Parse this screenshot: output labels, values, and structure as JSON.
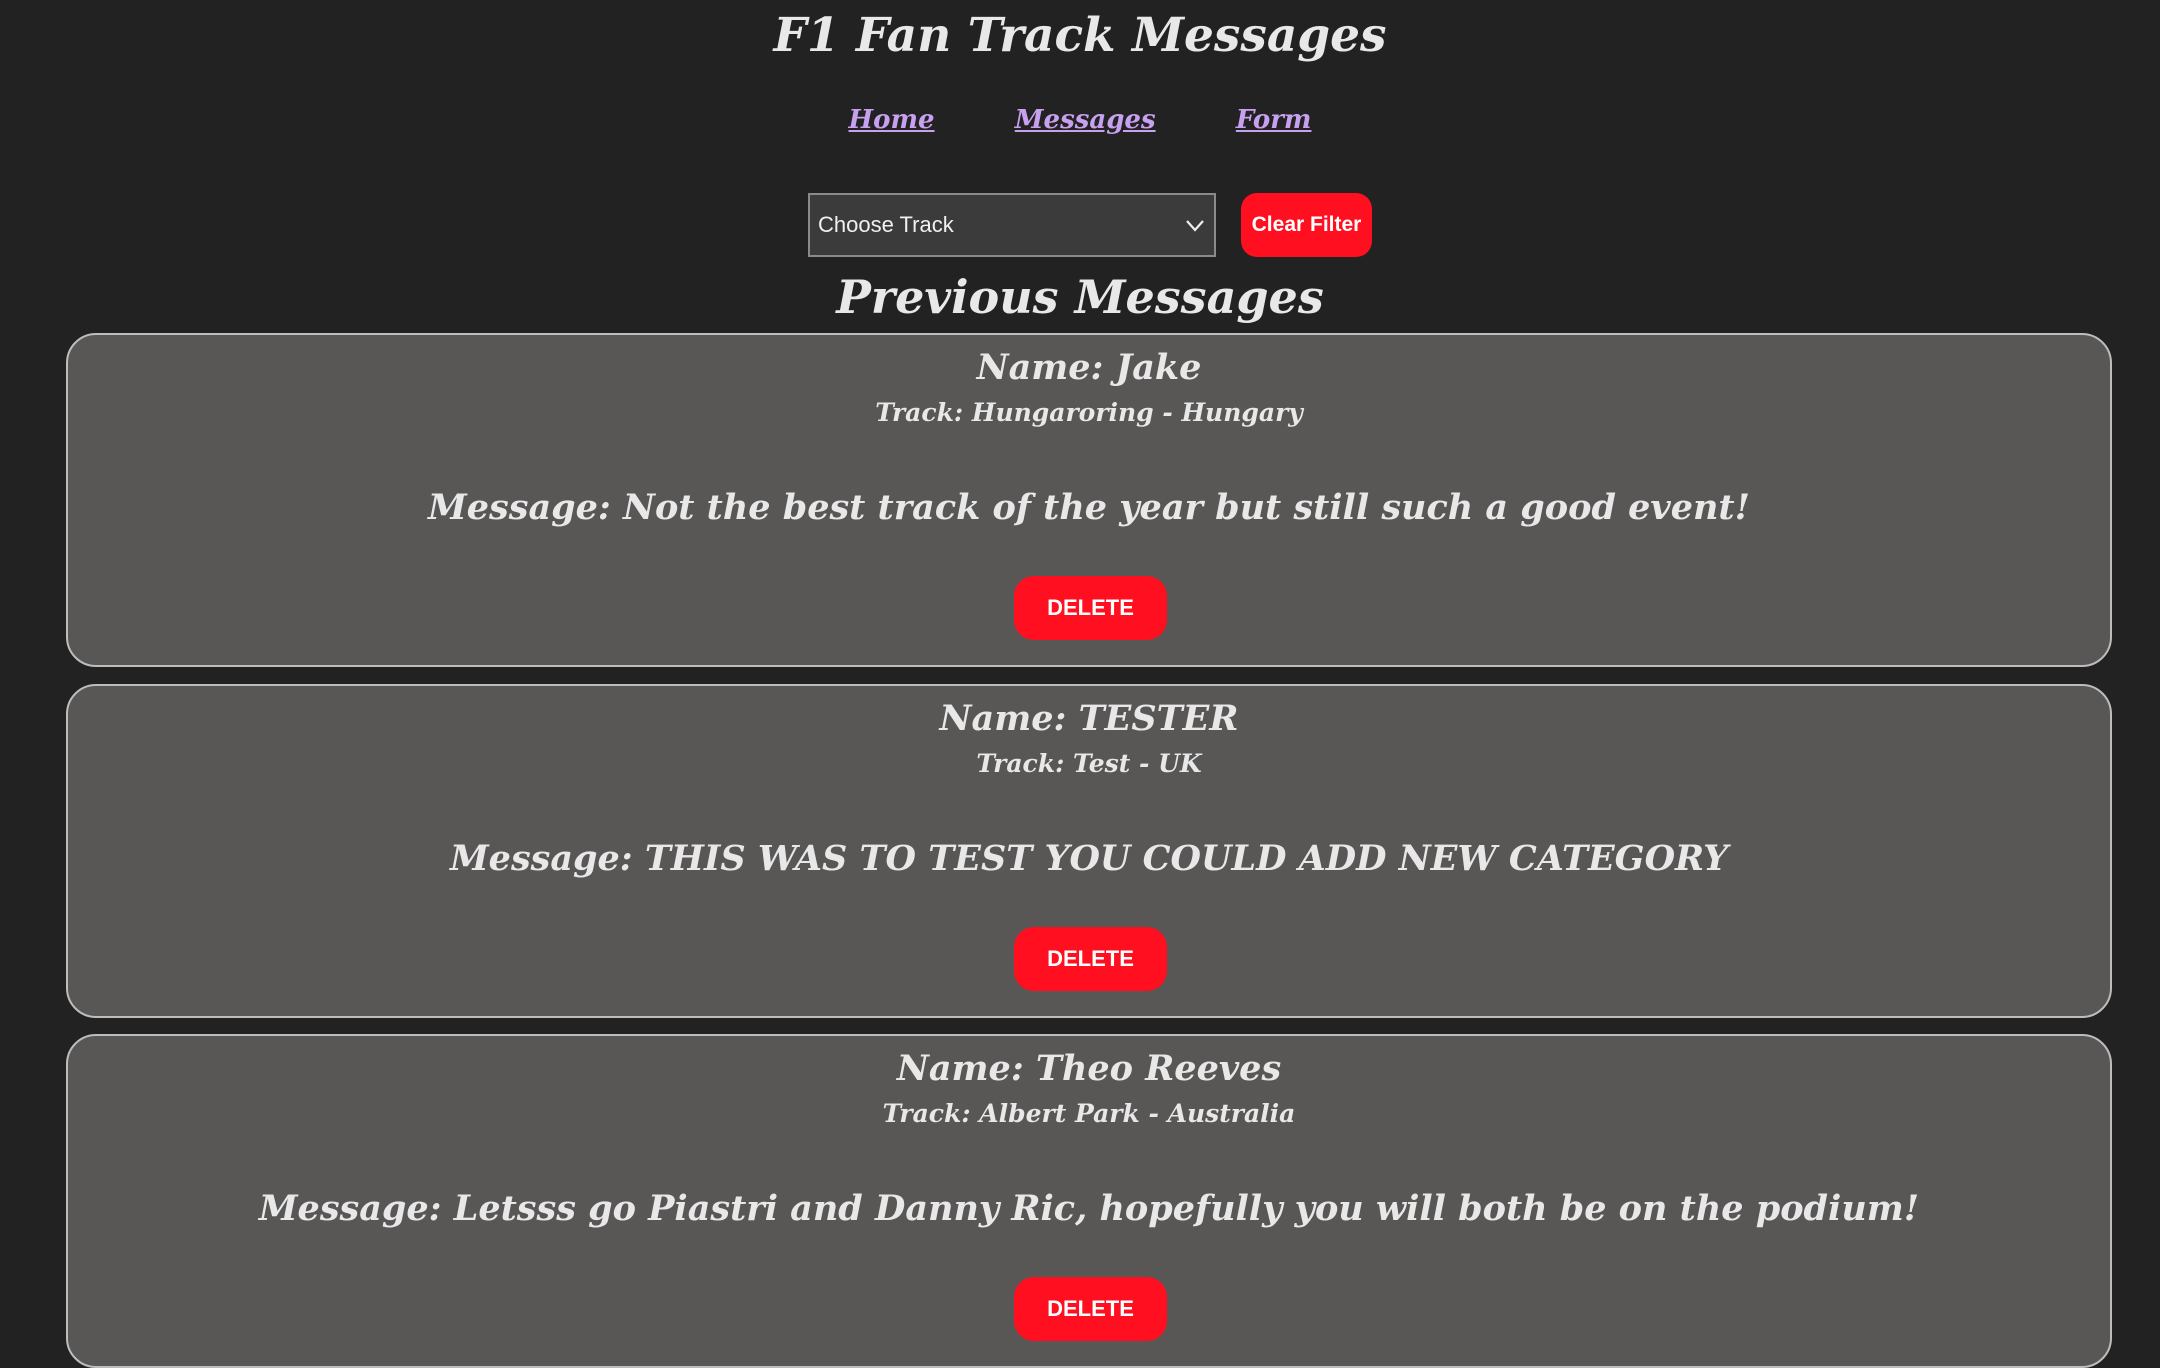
{
  "header": {
    "title": "F1 Fan Track Messages"
  },
  "nav": {
    "links": [
      {
        "label": "Home"
      },
      {
        "label": "Messages"
      },
      {
        "label": "Form"
      }
    ]
  },
  "filter": {
    "select_value": "Choose Track",
    "clear_label": "Clear Filter"
  },
  "section": {
    "title": "Previous Messages"
  },
  "messages": [
    {
      "name": "Name: Jake",
      "track": "Track: Hungaroring - Hungary",
      "message": "Message: Not the best track of the year but still such a good event!",
      "delete_label": "DELETE"
    },
    {
      "name": "Name: TESTER",
      "track": "Track: Test - UK",
      "message": "Message: THIS WAS TO TEST YOU COULD ADD NEW CATEGORY",
      "delete_label": "DELETE"
    },
    {
      "name": "Name: Theo Reeves",
      "track": "Track: Albert Park - Australia",
      "message": "Message: Letsss go Piastri and Danny Ric, hopefully you will both be on the podium!",
      "delete_label": "DELETE"
    }
  ],
  "colors": {
    "background": "#222222",
    "card": "#595656",
    "accent_red": "#ff0f1f",
    "link": "#c8a0f0"
  },
  "icons": {
    "select_arrow": "chevron-down-icon"
  }
}
